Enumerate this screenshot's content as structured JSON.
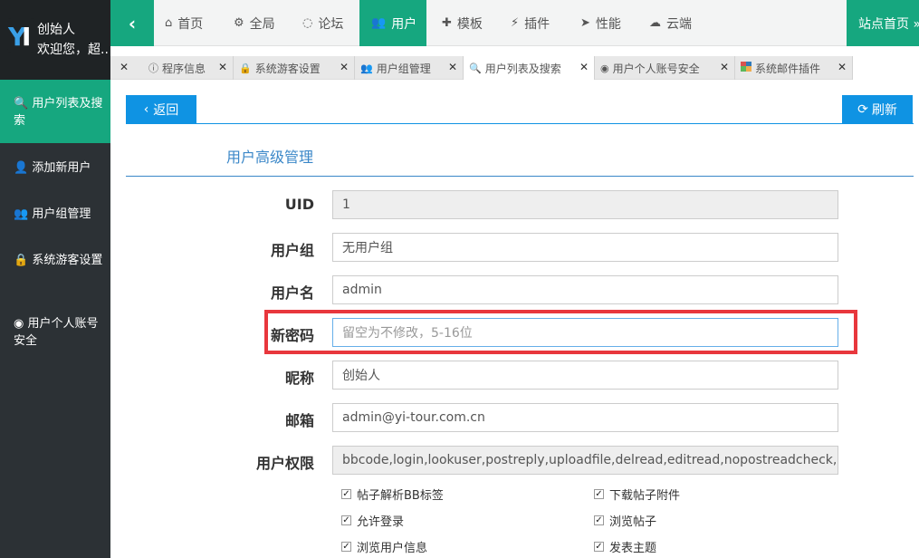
{
  "brand": {
    "logo_icon": "yi-logo-icon",
    "user_name": "创始人",
    "welcome": "欢迎您，超..."
  },
  "topnav": {
    "toggle_icon": "chevron-left-icon",
    "items": [
      {
        "icon": "home-icon",
        "label": "首页"
      },
      {
        "icon": "gears-icon",
        "label": "全局"
      },
      {
        "icon": "comments-icon",
        "label": "论坛"
      },
      {
        "icon": "users-icon",
        "label": "用户"
      },
      {
        "icon": "puzzle-icon",
        "label": "模板"
      },
      {
        "icon": "plug-icon",
        "label": "插件"
      },
      {
        "icon": "paper-plane-icon",
        "label": "性能"
      },
      {
        "icon": "cloud-icon",
        "label": "云端"
      }
    ],
    "active_index": 3,
    "site_home": "站点首页 »"
  },
  "tabs": {
    "items": [
      {
        "icon": "info-icon",
        "label": "程序信息"
      },
      {
        "icon": "lock-icon",
        "label": "系统游客设置"
      },
      {
        "icon": "users-icon",
        "label": "用户组管理"
      },
      {
        "icon": "search-icon",
        "label": "用户列表及搜索"
      },
      {
        "icon": "user-circle-icon",
        "label": "用户个人账号安全"
      },
      {
        "icon": "mail-plugin-icon",
        "label": "系统邮件插件"
      }
    ],
    "active_index": 3
  },
  "sidebar": {
    "items": [
      {
        "icon": "search-icon",
        "label": "用户列表及搜索"
      },
      {
        "icon": "user-plus-icon",
        "label": "添加新用户"
      },
      {
        "icon": "users-icon",
        "label": "用户组管理"
      },
      {
        "icon": "lock-icon",
        "label": "系统游客设置"
      },
      {
        "icon": "user-circle-icon",
        "label": "用户个人账号安全"
      }
    ],
    "active_index": 0
  },
  "main": {
    "back_label": "返回",
    "refresh_label": "刷新",
    "section_title": "用户高级管理",
    "fields": {
      "uid": {
        "label": "UID",
        "value": "1"
      },
      "group": {
        "label": "用户组",
        "value": "无用户组"
      },
      "username": {
        "label": "用户名",
        "value": "admin"
      },
      "password": {
        "label": "新密码",
        "value": "",
        "placeholder": "留空为不修改，5-16位"
      },
      "nickname": {
        "label": "昵称",
        "value": "创始人"
      },
      "email": {
        "label": "邮箱",
        "value": "admin@yi-tour.com.cn"
      },
      "permissions": {
        "label": "用户权限",
        "value": "bbcode,login,lookuser,postreply,uploadfile,delread,editread,nopostreadcheck,no"
      }
    },
    "permission_checkboxes": [
      {
        "label": "帖子解析BB标签",
        "checked": true
      },
      {
        "label": "下载帖子附件",
        "checked": true
      },
      {
        "label": "允许登录",
        "checked": true
      },
      {
        "label": "浏览帖子",
        "checked": true
      },
      {
        "label": "浏览用户信息",
        "checked": true
      },
      {
        "label": "发表主题",
        "checked": true
      }
    ]
  },
  "colors": {
    "accent": "#16a77f",
    "primary_button": "#0f93e3",
    "highlight_box": "#e8373d",
    "sidebar_bg": "#2c3135"
  }
}
